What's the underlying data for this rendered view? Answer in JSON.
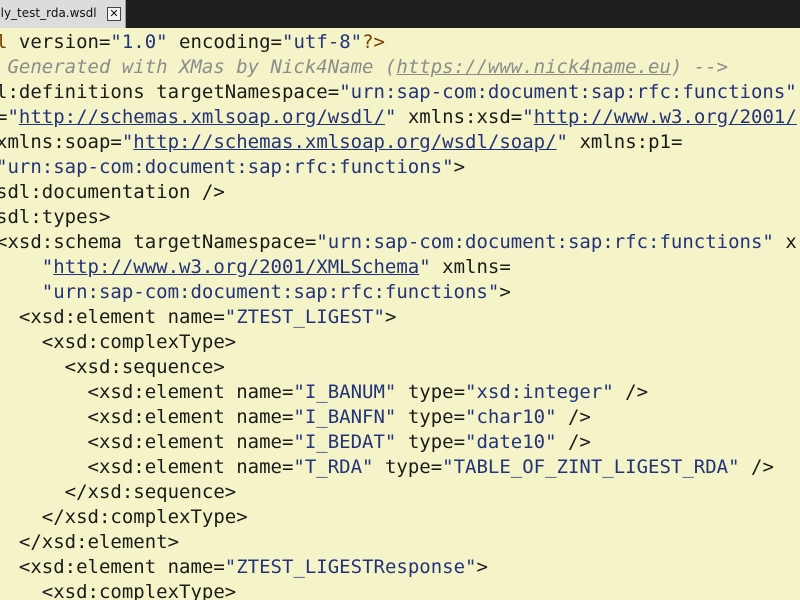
{
  "tab": {
    "label": "ply_test_rda.wsdl",
    "close_glyph": "✕"
  },
  "colors": {
    "editor_bg": "#f5f4c8",
    "tag": "#1a1a1a",
    "value": "#22337a",
    "comment": "#8c8c8c",
    "processing_instruction": "#7a3d00",
    "tabbar_bg": "#1f1f1f"
  },
  "code_lines": [
    [
      [
        "pi",
        "l"
      ],
      [
        "attr",
        " version="
      ],
      [
        "val",
        "\"1.0\""
      ],
      [
        "attr",
        " encoding="
      ],
      [
        "val",
        "\"utf-8\""
      ],
      [
        "pi",
        "?>"
      ]
    ],
    [
      [
        "com",
        " Generated with XMas by Nick4Name ("
      ],
      [
        "ctext",
        "https://www.nick4name.eu"
      ],
      [
        "com",
        ") -->"
      ]
    ],
    [
      [
        "tag",
        "l:definitions"
      ],
      [
        "attr",
        " targetNamespace="
      ],
      [
        "val",
        "\"urn:sap-com:document:sap:rfc:functions\""
      ]
    ],
    [
      [
        "attr",
        "="
      ],
      [
        "val",
        "\""
      ],
      [
        "url",
        "http://schemas.xmlsoap.org/wsdl/"
      ],
      [
        "val",
        "\""
      ],
      [
        "attr",
        " xmlns:xsd="
      ],
      [
        "val",
        "\""
      ],
      [
        "url",
        "http://www.w3.org/2001/"
      ]
    ],
    [
      [
        "attr",
        "xmlns:soap="
      ],
      [
        "val",
        "\""
      ],
      [
        "url",
        "http://schemas.xmlsoap.org/wsdl/soap/"
      ],
      [
        "val",
        "\""
      ],
      [
        "attr",
        " xmlns:p1="
      ]
    ],
    [
      [
        "val",
        "\"urn:sap-com:document:sap:rfc:functions\""
      ],
      [
        "tag",
        ">"
      ]
    ],
    [
      [
        "tag",
        "sdl:documentation />"
      ]
    ],
    [
      [
        "tag",
        "sdl:types>"
      ]
    ],
    [
      [
        "tag",
        "<xsd:schema"
      ],
      [
        "attr",
        " targetNamespace="
      ],
      [
        "val",
        "\"urn:sap-com:document:sap:rfc:functions\""
      ],
      [
        "attr",
        " x"
      ]
    ],
    [
      [
        "val",
        "    \""
      ],
      [
        "url",
        "http://www.w3.org/2001/XMLSchema"
      ],
      [
        "val",
        "\""
      ],
      [
        "attr",
        " xmlns="
      ]
    ],
    [
      [
        "val",
        "    \"urn:sap-com:document:sap:rfc:functions\""
      ],
      [
        "tag",
        ">"
      ]
    ],
    [
      [
        "tag",
        "  <xsd:element"
      ],
      [
        "attr",
        " name="
      ],
      [
        "val",
        "\"ZTEST_LIGEST\""
      ],
      [
        "tag",
        ">"
      ]
    ],
    [
      [
        "tag",
        "    <xsd:complexType>"
      ]
    ],
    [
      [
        "tag",
        "      <xsd:sequence>"
      ]
    ],
    [
      [
        "tag",
        "        <xsd:element"
      ],
      [
        "attr",
        " name="
      ],
      [
        "val",
        "\"I_BANUM\""
      ],
      [
        "attr",
        " type="
      ],
      [
        "val",
        "\"xsd:integer\""
      ],
      [
        "tag",
        " />"
      ]
    ],
    [
      [
        "tag",
        "        <xsd:element"
      ],
      [
        "attr",
        " name="
      ],
      [
        "val",
        "\"I_BANFN\""
      ],
      [
        "attr",
        " type="
      ],
      [
        "val",
        "\"char10\""
      ],
      [
        "tag",
        " />"
      ]
    ],
    [
      [
        "tag",
        "        <xsd:element"
      ],
      [
        "attr",
        " name="
      ],
      [
        "val",
        "\"I_BEDAT\""
      ],
      [
        "attr",
        " type="
      ],
      [
        "val",
        "\"date10\""
      ],
      [
        "tag",
        " />"
      ]
    ],
    [
      [
        "tag",
        "        <xsd:element"
      ],
      [
        "attr",
        " name="
      ],
      [
        "val",
        "\"T_RDA\""
      ],
      [
        "attr",
        " type="
      ],
      [
        "val",
        "\"TABLE_OF_ZINT_LIGEST_RDA\""
      ],
      [
        "tag",
        " />"
      ]
    ],
    [
      [
        "tag",
        "      </xsd:sequence>"
      ]
    ],
    [
      [
        "tag",
        "    </xsd:complexType>"
      ]
    ],
    [
      [
        "tag",
        "  </xsd:element>"
      ]
    ],
    [
      [
        "tag",
        "  <xsd:element"
      ],
      [
        "attr",
        " name="
      ],
      [
        "val",
        "\"ZTEST_LIGESTResponse\""
      ],
      [
        "tag",
        ">"
      ]
    ],
    [
      [
        "tag",
        "    <xsd:complexType>"
      ]
    ]
  ]
}
